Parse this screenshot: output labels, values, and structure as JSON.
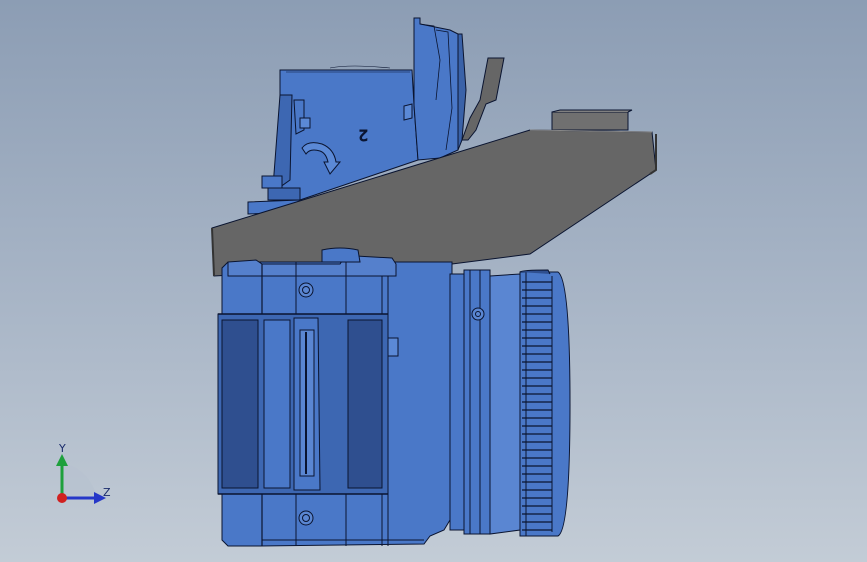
{
  "viewport": {
    "step_label": "2",
    "axes": {
      "y_label": "Y",
      "z_label": "Z"
    }
  },
  "colors": {
    "background_top": "#8c9db4",
    "background_bottom": "#c3ccd6",
    "part_blue": "#4a78c8",
    "part_blue_dark": "#2f4f8f",
    "edge_dark": "#0a1430",
    "top_plate_gray": "#666666",
    "axis_y": "#1ea03c",
    "axis_z": "#2637c8",
    "origin_red": "#d02020"
  },
  "icons": {
    "rotate_arrow": "curved-arrow-icon",
    "triad": "xyz-triad-icon"
  }
}
